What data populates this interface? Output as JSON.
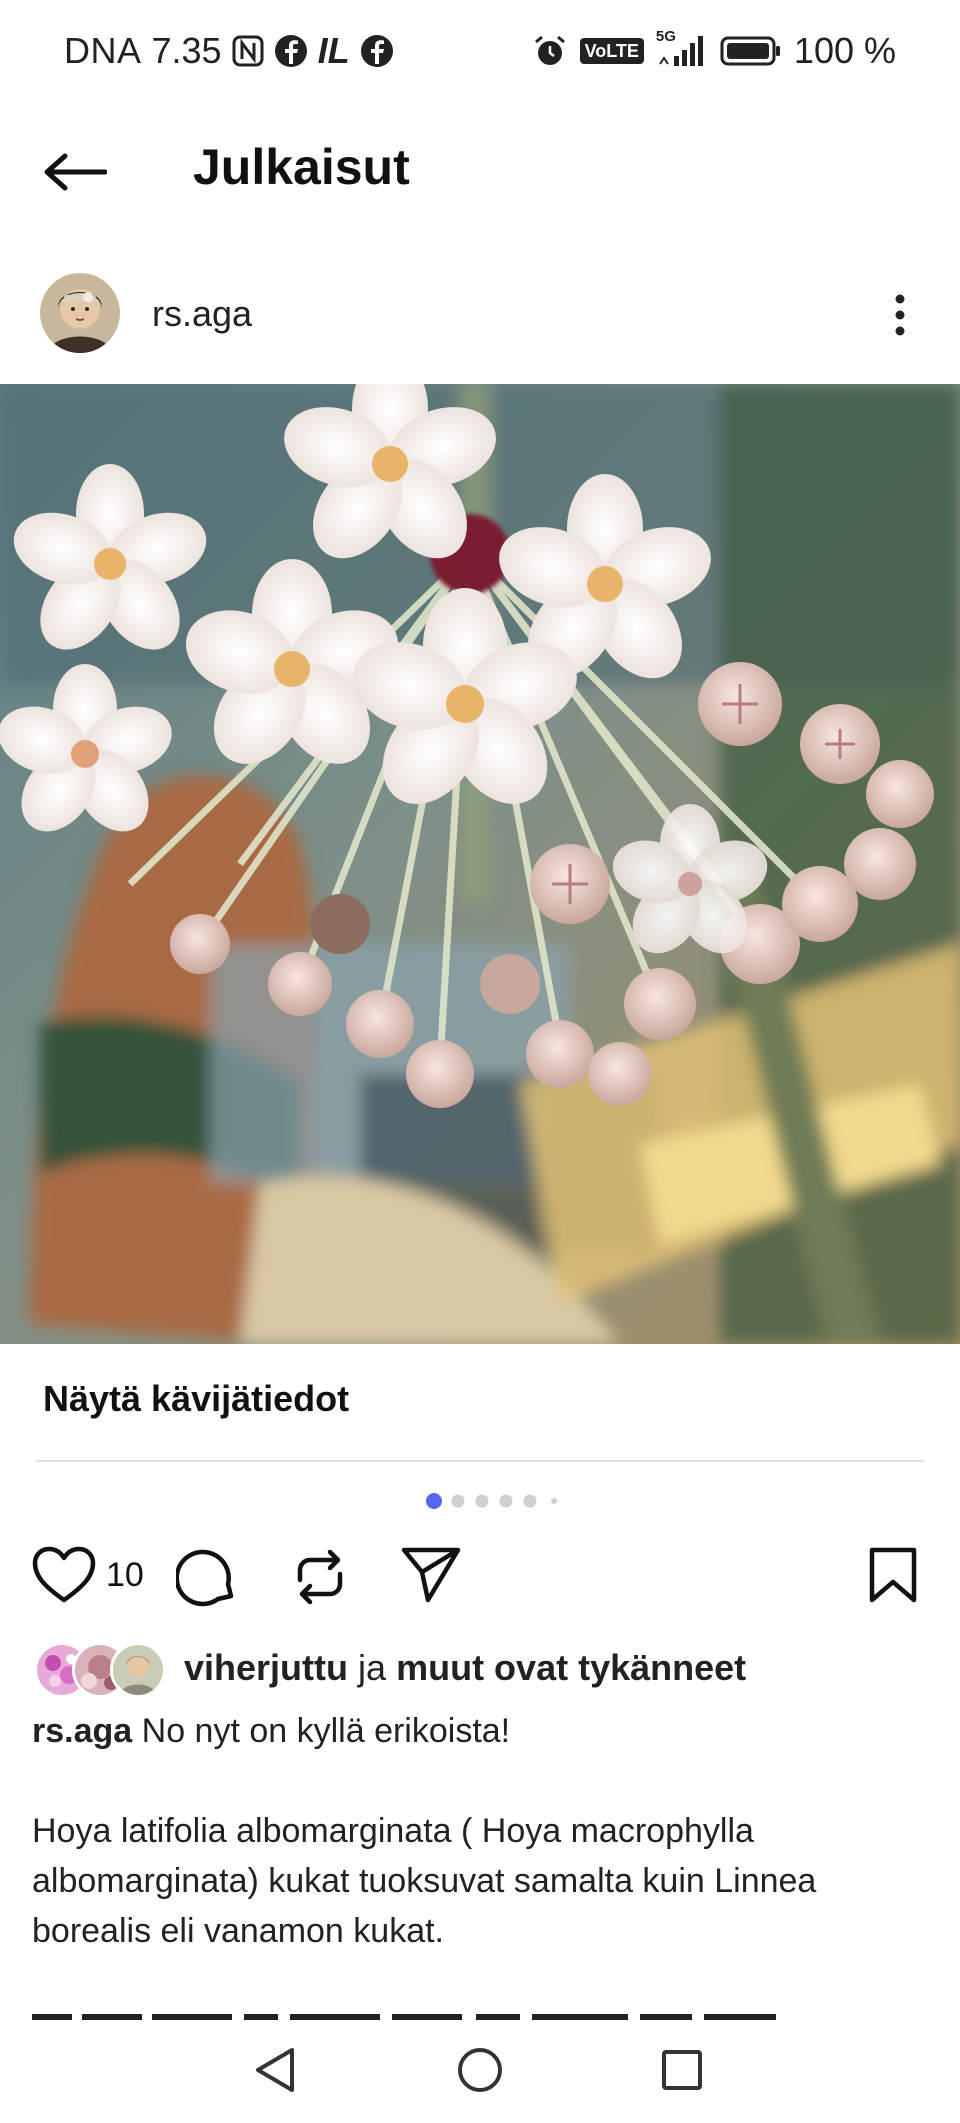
{
  "status_bar": {
    "carrier": "DNA",
    "time": "7.35",
    "left_icons": [
      "nfc-icon",
      "facebook-icon",
      "il-app-icon",
      "facebook-icon"
    ],
    "il_label": "IL",
    "volte_label": "VoLTE",
    "network_label": "5G",
    "battery_text": "100 %"
  },
  "header": {
    "title": "Julkaisut"
  },
  "post": {
    "username": "rs.aga",
    "insights_label": "Näytä kävijätiedot",
    "carousel": {
      "total": 6,
      "active_index": 0,
      "active_color": "#5865f2",
      "inactive_color": "#d0d0d0"
    },
    "like_count": "10",
    "liked_by": {
      "name": "viherjuttu",
      "joiner": "ja",
      "rest": "muut ovat tykänneet"
    },
    "caption": {
      "username": "rs.aga",
      "first_line": "No nyt on kyllä erikoista!",
      "paragraph": "Hoya latifolia albomarginata ( Hoya macrophylla albomarginata) kukat tuoksuvat samalta kuin Linnea borealis eli vanamon kukat."
    }
  },
  "colors": {
    "text": "#111111",
    "divider": "#e3e3e3",
    "carousel_active": "#5865f2"
  }
}
